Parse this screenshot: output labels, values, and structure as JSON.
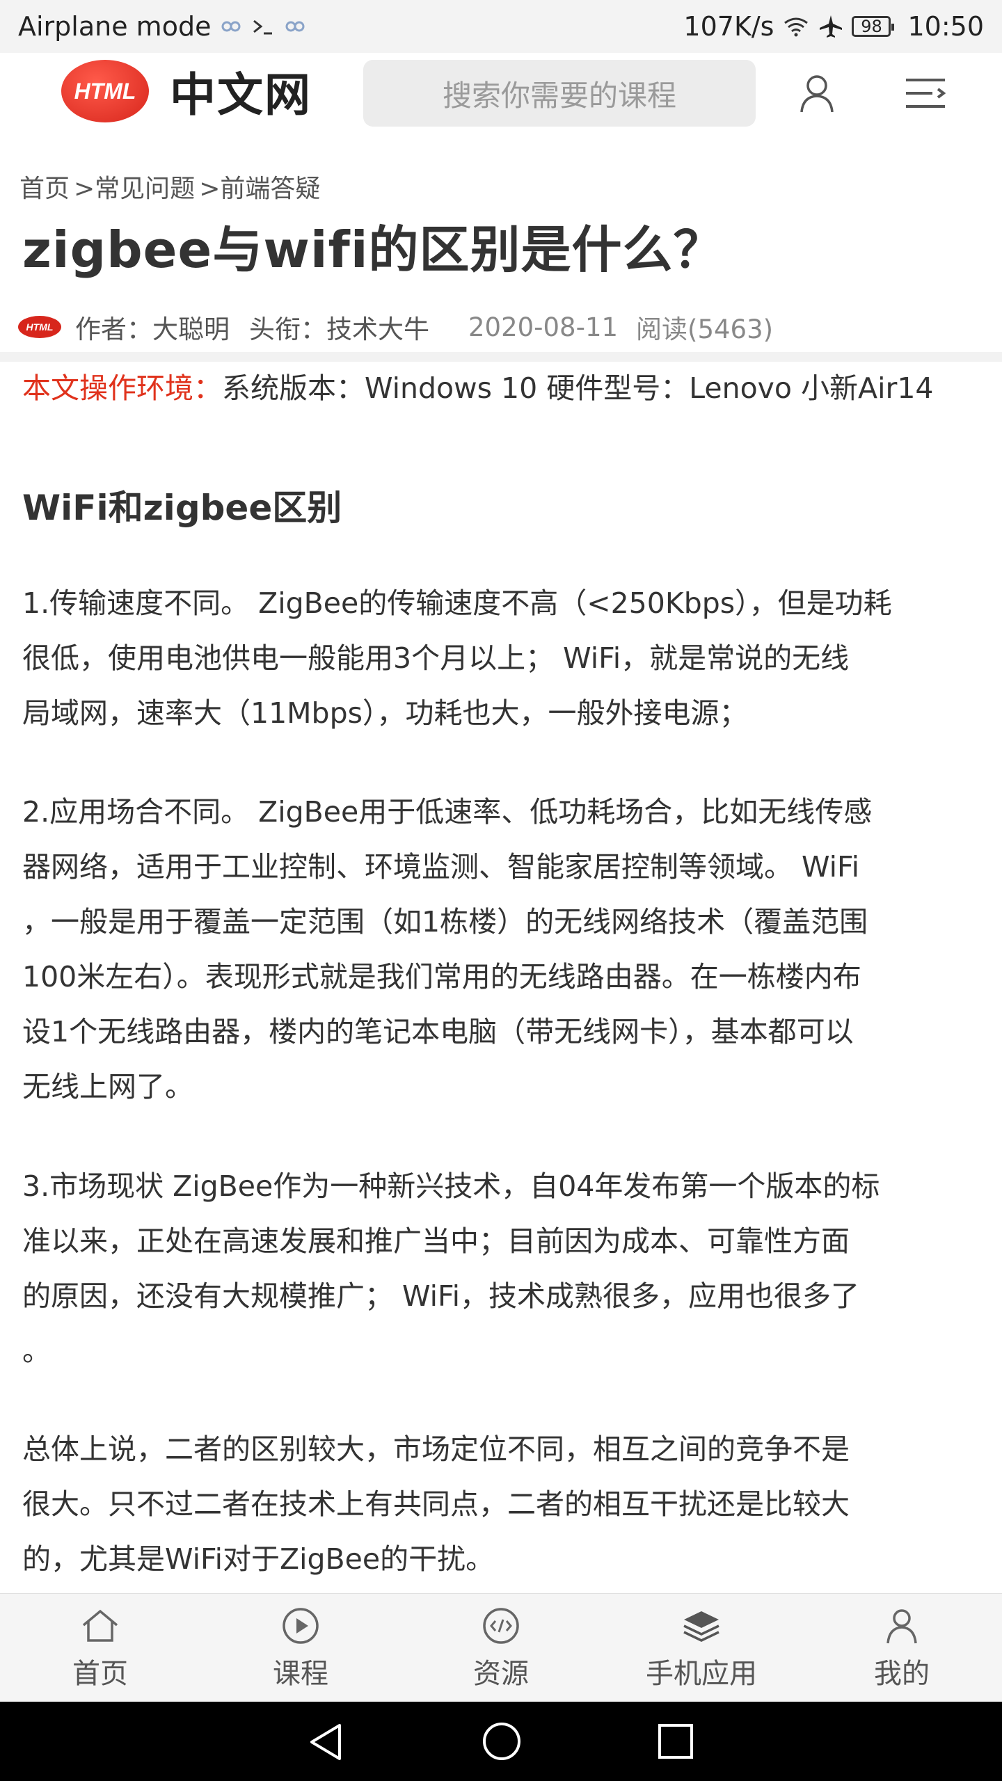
{
  "status_bar": {
    "left_text": "Airplane mode",
    "speed": "107K/s",
    "battery": "98",
    "time": "10:50"
  },
  "header": {
    "logo_badge": "HTML",
    "logo_text": "中文网",
    "search_placeholder": "搜索你需要的课程"
  },
  "breadcrumb": [
    "首页",
    ">常见问题",
    ">前端答疑"
  ],
  "article": {
    "title": "zigbee与wifi的区别是什么？",
    "author": "作者：大聪明",
    "rank": "头衔：技术大牛",
    "date": "2020-08-11",
    "reads": "阅读(5463)",
    "env_label": "本文操作环境：",
    "env_text": "系统版本：Windows 10 硬件型号：Lenovo 小新Air14",
    "section_title": "WiFi和zigbee区别",
    "para1": [
      "1.传输速度不同。 ZigBee的传输速度不高（<250Kbps），但是功耗",
      "很低，使用电池供电一般能用3个月以上； WiFi，就是常说的无线",
      "局域网，速率大（11Mbps），功耗也大，一般外接电源；"
    ],
    "para2": [
      "2.应用场合不同。 ZigBee用于低速率、低功耗场合，比如无线传感",
      "器网络，适用于工业控制、环境监测、智能家居控制等领域。 WiFi",
      "，一般是用于覆盖一定范围（如1栋楼）的无线网络技术（覆盖范围",
      "100米左右）。表现形式就是我们常用的无线路由器。在一栋楼内布",
      "设1个无线路由器，楼内的笔记本电脑（带无线网卡），基本都可以",
      "无线上网了。"
    ],
    "para3": [
      "3.市场现状 ZigBee作为一种新兴技术，自04年发布第一个版本的标",
      "准以来，正处在高速发展和推广当中；目前因为成本、可靠性方面",
      "的原因，还没有大规模推广； WiFi，技术成熟很多，应用也很多了",
      "。"
    ],
    "para4": [
      "总体上说，二者的区别较大，市场定位不同，相互之间的竞争不是",
      "很大。只不过二者在技术上有共同点，二者的相互干扰还是比较大",
      "的，尤其是WiFi对于ZigBee的干扰。"
    ]
  },
  "bottom_nav": {
    "home": "首页",
    "courses": "课程",
    "resources": "资源",
    "apps": "手机应用",
    "mine": "我的"
  },
  "colors": {
    "accent_red": "#e0321c",
    "logo_red": "#d7261c"
  }
}
